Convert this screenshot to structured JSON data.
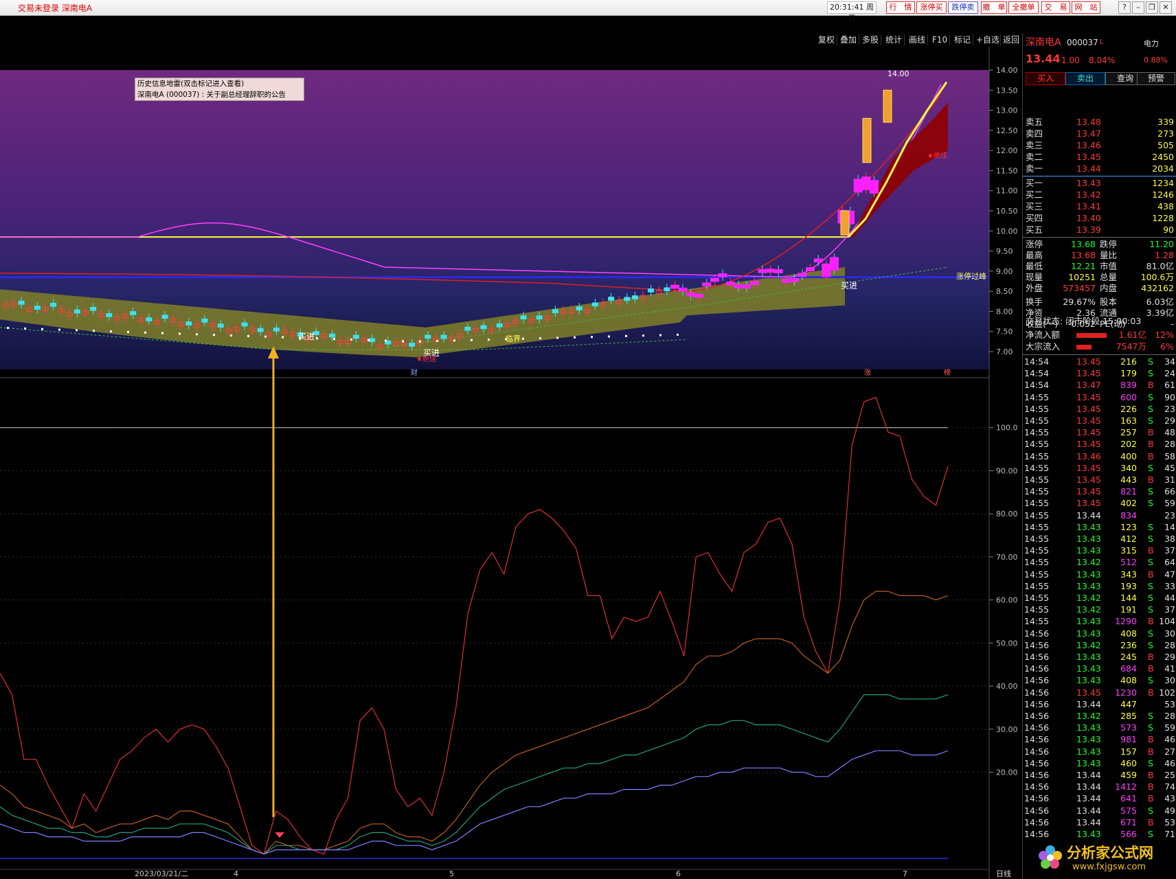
{
  "titlebar": {
    "app_title": "交易未登录   深南电A",
    "time": "20:31:41",
    "weekday": "周日",
    "buttons": [
      "行　情",
      "涨停买",
      "跌停卖",
      "撤　单",
      "全撤单",
      "交　易",
      "网　站"
    ]
  },
  "toolbar": {
    "items": [
      "复权",
      "叠加",
      "多股",
      "统计",
      "画线",
      "F10",
      "标记",
      "+自选",
      "返回"
    ]
  },
  "info_box": {
    "line1": "历史信息地雷(双击标记进入查看)",
    "line2": "深南电A (000037) : 关于副总经理辞职的公告"
  },
  "kline_axis": [
    "14.00",
    "13.50",
    "13.00",
    "12.50",
    "12.00",
    "11.50",
    "11.00",
    "10.50",
    "10.00",
    "9.50",
    "9.00",
    "8.50",
    "8.00",
    "7.50",
    "7.00"
  ],
  "osc_axis": [
    "100.0",
    "90.00",
    "80.00",
    "70.00",
    "60.00",
    "50.00",
    "40.00",
    "30.00",
    "20.00"
  ],
  "kline_labels": {
    "high_mark": "14.00",
    "buy1": "买进",
    "buy2": "买进",
    "buy3": "买进",
    "critical": "临界",
    "limit_break": "涨停过峰",
    "bottom": "★绝佳",
    "top_tag": "★绝佳",
    "cai": "财",
    "zhang": "涨",
    "bang": "榜"
  },
  "date_axis": {
    "d1": "2023/03/21/二",
    "d2": "4",
    "d3": "5",
    "d4": "6",
    "d5": "7",
    "period": "日线"
  },
  "stock": {
    "name": "深南电A",
    "code": "000037",
    "flag": "L",
    "industry": "电力",
    "price": "13.44",
    "change": "1.00",
    "pct": "8.04%",
    "industry_pct": "0.88%"
  },
  "actions": [
    "买入",
    "卖出",
    "查询",
    "预警"
  ],
  "asks": [
    {
      "label": "卖五",
      "price": "13.48",
      "vol": "339"
    },
    {
      "label": "卖四",
      "price": "13.47",
      "vol": "273"
    },
    {
      "label": "卖三",
      "price": "13.46",
      "vol": "505"
    },
    {
      "label": "卖二",
      "price": "13.45",
      "vol": "2450"
    },
    {
      "label": "卖一",
      "price": "13.44",
      "vol": "2034"
    }
  ],
  "bids": [
    {
      "label": "买一",
      "price": "13.43",
      "vol": "1234"
    },
    {
      "label": "买二",
      "price": "13.42",
      "vol": "1246"
    },
    {
      "label": "买三",
      "price": "13.41",
      "vol": "438"
    },
    {
      "label": "买四",
      "price": "13.40",
      "vol": "1228"
    },
    {
      "label": "买五",
      "price": "13.39",
      "vol": "90"
    }
  ],
  "stats": [
    {
      "l1": "涨停",
      "v1": "13.68",
      "l2": "跌停",
      "v2": "11.20"
    },
    {
      "l1": "最高",
      "v1": "13.68",
      "l2": "量比",
      "v2": "1.28"
    },
    {
      "l1": "最低",
      "v1": "12.21",
      "l2": "市值",
      "v2": "81.0亿"
    },
    {
      "l1": "现量",
      "v1": "10251",
      "l2": "总量",
      "v2": "100.6万"
    },
    {
      "l1": "外盘",
      "v1": "573457",
      "l2": "内盘",
      "v2": "432162"
    },
    {
      "l1": "换手",
      "v1": "29.67%",
      "l2": "股本",
      "v2": "6.03亿"
    },
    {
      "l1": "净资",
      "v1": "2.36",
      "l2": "流通",
      "v2": "3.39亿"
    },
    {
      "l1": "收益(一)",
      "v1": "-0.052",
      "l2": "PE(动)",
      "v2": "-"
    }
  ],
  "trade_state": "交易状态: 闭市阶段 15:00:03",
  "flows": [
    {
      "label": "净流入额",
      "value": "1.61亿",
      "pct": "12%"
    },
    {
      "label": "大宗流入",
      "value": "7547万",
      "pct": "6%"
    }
  ],
  "ticks": [
    [
      "14:54",
      "13.45",
      "216",
      "S",
      "34"
    ],
    [
      "14:54",
      "13.45",
      "179",
      "S",
      "24"
    ],
    [
      "14:54",
      "13.47",
      "839",
      "B",
      "61"
    ],
    [
      "14:55",
      "13.45",
      "600",
      "S",
      "90"
    ],
    [
      "14:55",
      "13.45",
      "226",
      "S",
      "23"
    ],
    [
      "14:55",
      "13.45",
      "163",
      "S",
      "29"
    ],
    [
      "14:55",
      "13.45",
      "257",
      "B",
      "48"
    ],
    [
      "14:55",
      "13.45",
      "202",
      "B",
      "28"
    ],
    [
      "14:55",
      "13.46",
      "400",
      "B",
      "58"
    ],
    [
      "14:55",
      "13.45",
      "340",
      "S",
      "45"
    ],
    [
      "14:55",
      "13.45",
      "443",
      "B",
      "31"
    ],
    [
      "14:55",
      "13.45",
      "821",
      "S",
      "66"
    ],
    [
      "14:55",
      "13.45",
      "402",
      "S",
      "59"
    ],
    [
      "14:55",
      "13.44",
      "834",
      "",
      "23"
    ],
    [
      "14:55",
      "13.43",
      "123",
      "S",
      "14"
    ],
    [
      "14:55",
      "13.43",
      "412",
      "S",
      "38"
    ],
    [
      "14:55",
      "13.43",
      "315",
      "B",
      "37"
    ],
    [
      "14:55",
      "13.42",
      "512",
      "S",
      "64"
    ],
    [
      "14:55",
      "13.43",
      "343",
      "B",
      "47"
    ],
    [
      "14:55",
      "13.43",
      "193",
      "S",
      "33"
    ],
    [
      "14:55",
      "13.42",
      "144",
      "S",
      "44"
    ],
    [
      "14:55",
      "13.42",
      "191",
      "S",
      "37"
    ],
    [
      "14:55",
      "13.43",
      "1290",
      "B",
      "104"
    ],
    [
      "14:56",
      "13.43",
      "408",
      "S",
      "30"
    ],
    [
      "14:56",
      "13.42",
      "236",
      "S",
      "28"
    ],
    [
      "14:56",
      "13.43",
      "245",
      "B",
      "29"
    ],
    [
      "14:56",
      "13.43",
      "684",
      "B",
      "41"
    ],
    [
      "14:56",
      "13.43",
      "408",
      "S",
      "30"
    ],
    [
      "14:56",
      "13.45",
      "1230",
      "B",
      "102"
    ],
    [
      "14:56",
      "13.44",
      "447",
      "",
      "53"
    ],
    [
      "14:56",
      "13.42",
      "285",
      "S",
      "28"
    ],
    [
      "14:56",
      "13.43",
      "573",
      "S",
      "59"
    ],
    [
      "14:56",
      "13.43",
      "981",
      "B",
      "46"
    ],
    [
      "14:56",
      "13.43",
      "157",
      "B",
      "27"
    ],
    [
      "14:56",
      "13.43",
      "460",
      "S",
      "46"
    ],
    [
      "14:56",
      "13.44",
      "459",
      "B",
      "25"
    ],
    [
      "14:56",
      "13.44",
      "1412",
      "B",
      "74"
    ],
    [
      "14:56",
      "13.44",
      "641",
      "B",
      "43"
    ],
    [
      "14:56",
      "13.44",
      "575",
      "S",
      "49"
    ],
    [
      "14:56",
      "13.44",
      "671",
      "B",
      "53"
    ],
    [
      "14:56",
      "13.43",
      "566",
      "S",
      "71"
    ]
  ],
  "watermark": {
    "text": "分析家公式网",
    "url": "www.fxjgsw.com"
  },
  "colors": {
    "up": "#ff3a3a",
    "down": "#20ff20",
    "bg": "#000000"
  },
  "chart_data": {
    "type": "line",
    "title": "",
    "x_dates": [
      "2023/03/21/二",
      "4",
      "5",
      "6",
      "7"
    ],
    "kline": {
      "ylim": [
        7.0,
        14.0
      ],
      "price_high": "14.00",
      "ma_lines": [
        "yellow",
        "magenta",
        "red"
      ],
      "resistance_level": 9.85,
      "support_level": 8.85
    },
    "oscillator": {
      "ylim": [
        0,
        110
      ],
      "series": [
        {
          "color": "#e03030",
          "values": [
            43,
            38,
            23,
            23,
            17,
            12,
            7,
            15,
            11,
            17,
            23,
            25,
            28,
            30,
            27,
            30,
            31,
            30,
            26,
            21,
            12,
            3,
            1,
            11,
            9,
            5,
            2,
            1,
            9,
            14,
            32,
            35,
            30,
            16,
            12,
            14,
            10,
            20,
            35,
            57,
            67,
            71,
            66,
            77,
            80,
            81,
            79,
            76,
            72,
            61,
            61,
            51,
            56,
            55,
            56,
            62,
            55,
            47,
            70,
            71,
            66,
            62,
            71,
            73,
            78,
            79,
            73,
            56,
            48,
            43,
            60,
            96,
            106,
            107,
            99,
            98,
            88,
            84,
            82,
            91
          ]
        },
        {
          "color": "#c06020",
          "values": [
            17,
            15,
            12,
            11,
            10,
            9,
            7,
            8,
            6,
            7,
            8,
            8,
            9,
            10,
            9,
            11,
            11,
            10,
            9,
            8,
            5,
            2,
            1,
            4,
            3,
            3,
            2,
            2,
            3,
            4,
            7,
            8,
            8,
            6,
            5,
            5,
            4,
            6,
            9,
            13,
            17,
            20,
            22,
            24,
            25,
            26,
            27,
            28,
            29,
            30,
            31,
            32,
            33,
            34,
            35,
            37,
            39,
            41,
            45,
            47,
            47,
            48,
            50,
            51,
            51,
            51,
            50,
            47,
            45,
            43,
            46,
            54,
            60,
            62,
            62,
            61,
            61,
            61,
            60,
            61
          ]
        },
        {
          "color": "#20a080",
          "values": [
            12,
            10,
            9,
            8,
            7,
            7,
            6,
            6,
            5,
            5,
            6,
            6,
            7,
            7,
            7,
            8,
            8,
            8,
            7,
            6,
            4,
            2,
            1,
            3,
            3,
            2,
            2,
            2,
            2,
            3,
            5,
            6,
            6,
            5,
            4,
            4,
            3,
            4,
            6,
            9,
            12,
            14,
            16,
            17,
            18,
            19,
            20,
            21,
            21,
            22,
            22,
            23,
            24,
            24,
            25,
            26,
            27,
            28,
            30,
            31,
            31,
            32,
            32,
            31,
            31,
            31,
            30,
            29,
            28,
            27,
            30,
            34,
            38,
            38,
            38,
            37,
            37,
            37,
            37,
            38
          ]
        },
        {
          "color": "#8080ff",
          "values": [
            8,
            7,
            6,
            6,
            5,
            5,
            5,
            4,
            4,
            4,
            4,
            5,
            5,
            5,
            5,
            5,
            6,
            6,
            5,
            4,
            3,
            2,
            1,
            2,
            2,
            2,
            2,
            2,
            2,
            2,
            3,
            4,
            4,
            3,
            3,
            3,
            2,
            3,
            4,
            6,
            8,
            9,
            10,
            11,
            12,
            12,
            13,
            14,
            14,
            15,
            15,
            15,
            16,
            16,
            16,
            17,
            17,
            18,
            19,
            19,
            20,
            20,
            21,
            21,
            21,
            21,
            20,
            20,
            19,
            19,
            21,
            23,
            24,
            25,
            25,
            25,
            24,
            24,
            24,
            25
          ]
        }
      ]
    }
  }
}
